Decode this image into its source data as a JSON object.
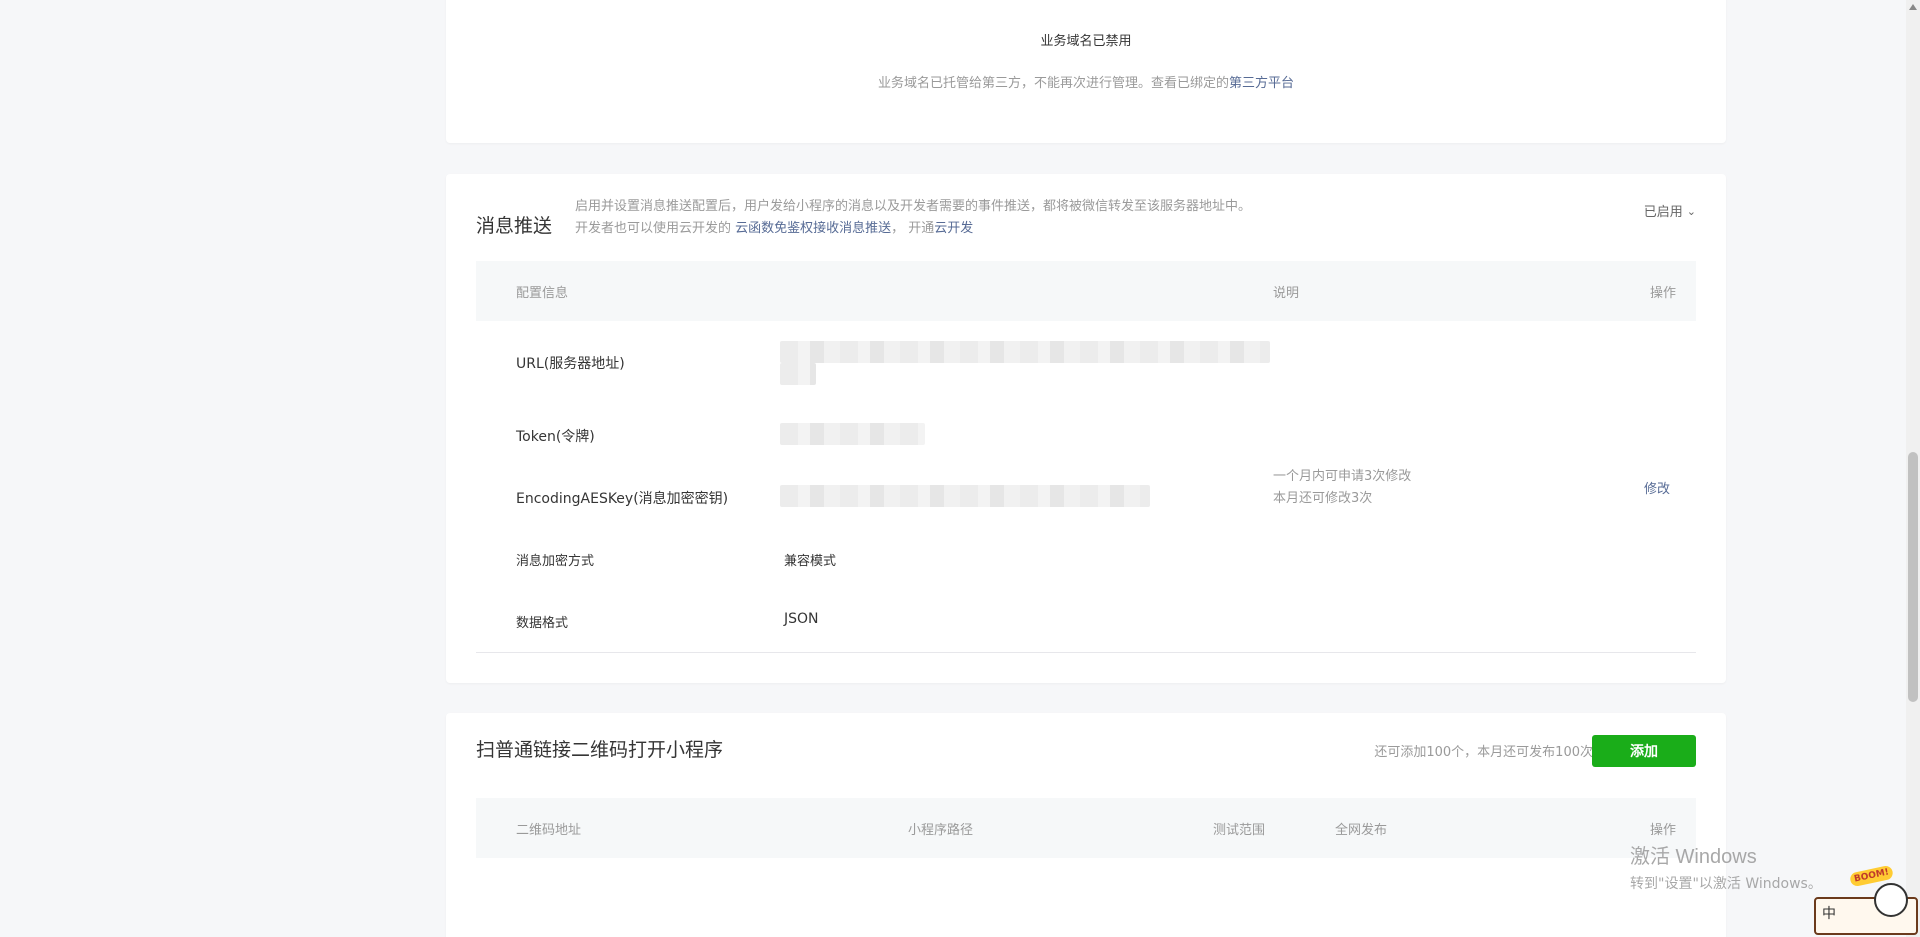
{
  "domain_card": {
    "title": "业务域名已禁用",
    "desc_prefix": "业务域名已托管给第三方，不能再次进行管理。查看已绑定的",
    "desc_link": "第三方平台"
  },
  "push_card": {
    "title": "消息推送",
    "intro_line1": "启用并设置消息推送配置后，用户发给小程序的消息以及开发者需要的事件推送，都将被微信转发至该服务器地址中。",
    "intro_line2_prefix": "开发者也可以使用云开发的 ",
    "intro_line2_link1": "云函数免鉴权接收消息推送",
    "intro_line2_mid": "， 开通",
    "intro_line2_link2": "云开发",
    "status": "已启用",
    "header": {
      "config": "配置信息",
      "desc": "说明",
      "action": "操作"
    },
    "rows": {
      "url_label": "URL(服务器地址)",
      "token_label": "Token(令牌)",
      "aes_label": "EncodingAESKey(消息加密密钥)",
      "encrypt_label": "消息加密方式",
      "encrypt_value": "兼容模式",
      "format_label": "数据格式",
      "format_value": "JSON"
    },
    "note_line1": "一个月内可申请3次修改",
    "note_line2": "本月还可修改3次",
    "modify": "修改"
  },
  "qr_card": {
    "title": "扫普通链接二维码打开小程序",
    "quota": "还可添加100个，本月还可发布100次。",
    "add_button": "添加",
    "header": {
      "qr_url": "二维码地址",
      "path": "小程序路径",
      "test_range": "测试范围",
      "publish": "全网发布",
      "action": "操作"
    }
  },
  "watermark": {
    "line1": "激活 Windows",
    "line2": "转到\"设置\"以激活 Windows。"
  },
  "ime": {
    "char": "中",
    "boom": "BOOM!"
  },
  "colors": {
    "link": "#576b95",
    "primary_button": "#1aad19",
    "table_header_bg": "#f6f8f9",
    "page_bg": "#f6f7f9"
  }
}
